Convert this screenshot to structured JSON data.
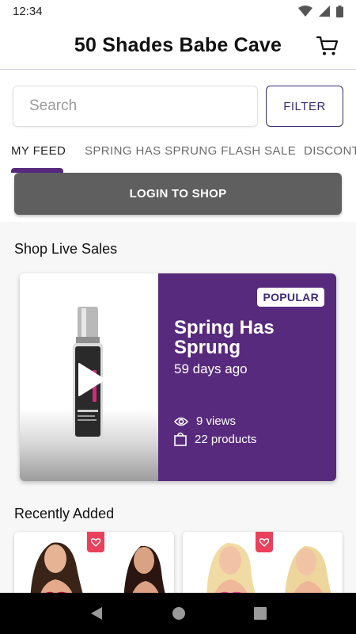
{
  "status_bar": {
    "time": "12:34"
  },
  "header": {
    "title": "50 Shades Babe Cave"
  },
  "search": {
    "placeholder": "Search",
    "filter_label": "FILTER"
  },
  "tabs": [
    {
      "label": "MY FEED",
      "active": true
    },
    {
      "label": "SPRING HAS SPRUNG FLASH SALE",
      "active": false
    },
    {
      "label": "DISCONT",
      "active": false
    }
  ],
  "login": {
    "label": "LOGIN TO SHOP"
  },
  "live_sales": {
    "title": "Shop Live Sales",
    "card": {
      "badge": "POPULAR",
      "name": "Spring Has Sprung",
      "age": "59 days ago",
      "views": "9 views",
      "products": "22 products"
    }
  },
  "recently_added": {
    "title": "Recently Added"
  },
  "colors": {
    "brand_purple": "#572a7d",
    "accent_navy": "#3b2a75",
    "login_gray": "#5f5f5f",
    "heart_tag": "#e9415b"
  },
  "icons": [
    "wifi-icon",
    "signal-icon",
    "battery-icon",
    "cart-icon",
    "play-icon",
    "eye-icon",
    "bag-icon",
    "heart-icon",
    "back-icon",
    "home-icon",
    "recents-icon"
  ]
}
